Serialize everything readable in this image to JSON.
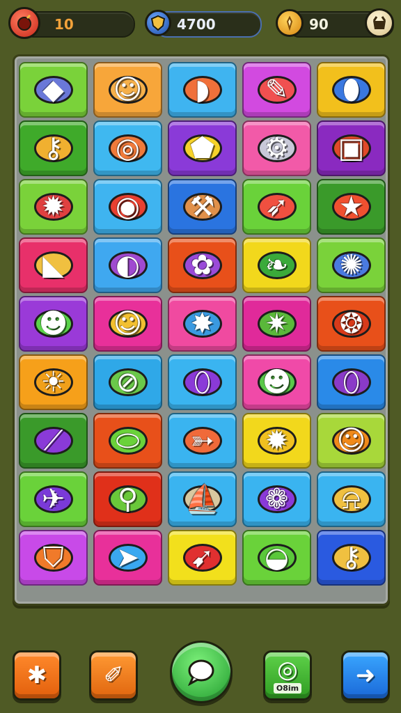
{
  "hud": {
    "lives": {
      "value": "10",
      "icon": "bomb-icon"
    },
    "score": {
      "value": "4700",
      "icon": "shield-icon"
    },
    "coins": {
      "value": "90",
      "icon": "coin-icon"
    },
    "shop": {
      "icon": "shop-icon"
    }
  },
  "board": {
    "rows": [
      [
        {
          "bg": "#7ad23a",
          "icon": "shell-icon",
          "glyph": "◆",
          "blob": "#6a78d8"
        },
        {
          "bg": "#f7a63a",
          "icon": "smiley-icon",
          "glyph": "☺",
          "blob": "#f6b04a"
        },
        {
          "bg": "#3fb4f0",
          "icon": "helmet-icon",
          "glyph": "◗",
          "blob": "#f0703a"
        },
        {
          "bg": "#d24ae0",
          "icon": "crayon-icon",
          "glyph": "✎",
          "blob": "#f05050"
        },
        {
          "bg": "#f2c01c",
          "icon": "capsule-icon",
          "glyph": "⬮",
          "blob": "#3a78e0"
        }
      ],
      [
        {
          "bg": "#3faa2a",
          "icon": "key-icon",
          "glyph": "⚷",
          "blob": "#f0b030"
        },
        {
          "bg": "#3fb8f0",
          "icon": "donut-icon",
          "glyph": "◎",
          "blob": "#f07a3a"
        },
        {
          "bg": "#8a3ad8",
          "icon": "cheese-icon",
          "glyph": "⬟",
          "blob": "#f6d22a"
        },
        {
          "bg": "#f25aa8",
          "icon": "gear-icon",
          "glyph": "⚙",
          "blob": "#c8c8d8"
        },
        {
          "bg": "#8a2ac0",
          "icon": "frame-icon",
          "glyph": "▣",
          "blob": "#e04a2a"
        }
      ],
      [
        {
          "bg": "#7ad23a",
          "icon": "splat-icon",
          "glyph": "✹",
          "blob": "#e04040"
        },
        {
          "bg": "#3fb4f0",
          "icon": "monster-mouth-icon",
          "glyph": "◉",
          "blob": "#e84030"
        },
        {
          "bg": "#2a74e0",
          "icon": "hammer-icon",
          "glyph": "⚒",
          "blob": "#e0904a"
        },
        {
          "bg": "#6ad23a",
          "icon": "rocket-icon",
          "glyph": "➶",
          "blob": "#f05040"
        },
        {
          "bg": "#3a9a2a",
          "icon": "star-icon",
          "glyph": "★",
          "blob": "#f05030"
        }
      ],
      [
        {
          "bg": "#e8306a",
          "icon": "horn-icon",
          "glyph": "◣",
          "blob": "#f0c040"
        },
        {
          "bg": "#3fa8f0",
          "icon": "bomb-bird-icon",
          "glyph": "◐",
          "blob": "#a04ad0"
        },
        {
          "bg": "#e8501a",
          "icon": "ghost-icon",
          "glyph": "✿",
          "blob": "#9a4ad8"
        },
        {
          "bg": "#f2d81c",
          "icon": "leaf-icon",
          "glyph": "❧",
          "blob": "#3aaa3a"
        },
        {
          "bg": "#7ad23a",
          "icon": "virus-icon",
          "glyph": "✺",
          "blob": "#4a7ae0"
        }
      ],
      [
        {
          "bg": "#9a3ad8",
          "icon": "slime-icon",
          "glyph": "☻",
          "blob": "#5ad24a"
        },
        {
          "bg": "#e8309a",
          "icon": "lemon-face-icon",
          "glyph": "☺",
          "blob": "#f2c030"
        },
        {
          "bg": "#f04aa0",
          "icon": "germ-icon",
          "glyph": "✸",
          "blob": "#3a9ae0"
        },
        {
          "bg": "#e02a9a",
          "icon": "sun-face-icon",
          "glyph": "✷",
          "blob": "#5ab83a"
        },
        {
          "bg": "#e8501a",
          "icon": "spiral-icon",
          "glyph": "❂",
          "blob": "#d83a1a"
        }
      ],
      [
        {
          "bg": "#f6a01a",
          "icon": "lion-icon",
          "glyph": "☀",
          "blob": "#f0a01a"
        },
        {
          "bg": "#2fa8e8",
          "icon": "planet-icon",
          "glyph": "⊘",
          "blob": "#6ac84a"
        },
        {
          "bg": "#3ab4f0",
          "icon": "eggplant-icon",
          "glyph": "⬯",
          "blob": "#8a3ad8"
        },
        {
          "bg": "#f04aa8",
          "icon": "frog-icon",
          "glyph": "☻",
          "blob": "#5ac84a"
        },
        {
          "bg": "#2a8ae8",
          "icon": "lightbulb-icon",
          "glyph": "⬯",
          "blob": "#8a3ac8"
        }
      ],
      [
        {
          "bg": "#3a9a2a",
          "icon": "baton-icon",
          "glyph": "⟋",
          "blob": "#8a3ad8"
        },
        {
          "bg": "#e8501a",
          "icon": "pill-icon",
          "glyph": "⬭",
          "blob": "#6ad23a"
        },
        {
          "bg": "#3ab4f0",
          "icon": "fish-icon",
          "glyph": "➳",
          "blob": "#f06a3a"
        },
        {
          "bg": "#f2d81c",
          "icon": "sun-icon",
          "glyph": "✹",
          "blob": "#f0c020"
        },
        {
          "bg": "#a8d83a",
          "icon": "critter-icon",
          "glyph": "☺",
          "blob": "#f08a1a"
        }
      ],
      [
        {
          "bg": "#6ad23a",
          "icon": "jet-icon",
          "glyph": "✈",
          "blob": "#7a3ad8"
        },
        {
          "bg": "#e0301a",
          "icon": "lollipop-icon",
          "glyph": "⚲",
          "blob": "#6ac83a"
        },
        {
          "bg": "#3ab4f0",
          "icon": "boat-icon",
          "glyph": "⛵",
          "blob": "#d8c8a0"
        },
        {
          "bg": "#3ab4f0",
          "icon": "flower-icon",
          "glyph": "❁",
          "blob": "#8a3ad8"
        },
        {
          "bg": "#3ab4f0",
          "icon": "bell-icon",
          "glyph": "⍾",
          "blob": "#f0c040"
        }
      ],
      [
        {
          "bg": "#c84ae8",
          "icon": "shield-emblem-icon",
          "glyph": "⛉",
          "blob": "#f07a2a"
        },
        {
          "bg": "#e8309a",
          "icon": "paper-plane-icon",
          "glyph": "➤",
          "blob": "#3aa8f0"
        },
        {
          "bg": "#f2e01c",
          "icon": "shard-icon",
          "glyph": "➹",
          "blob": "#e03030"
        },
        {
          "bg": "#6ad23a",
          "icon": "bird-icon",
          "glyph": "◒",
          "blob": "#5ac83a"
        },
        {
          "bg": "#2a5ae0",
          "icon": "bone-icon",
          "glyph": "⚷",
          "blob": "#f0c040"
        }
      ]
    ]
  },
  "buttons": {
    "btn1": {
      "icon": "puzzle-icon",
      "glyph": "✱"
    },
    "btn2": {
      "icon": "magic-wand-icon",
      "glyph": "✐"
    },
    "center": {
      "icon": "chat-bubble-icon",
      "glyph": "●"
    },
    "btn4": {
      "icon": "refresh-icon",
      "glyph": "◎",
      "label": "O8im"
    },
    "btn5": {
      "icon": "arrow-right-icon",
      "glyph": "➜"
    }
  }
}
